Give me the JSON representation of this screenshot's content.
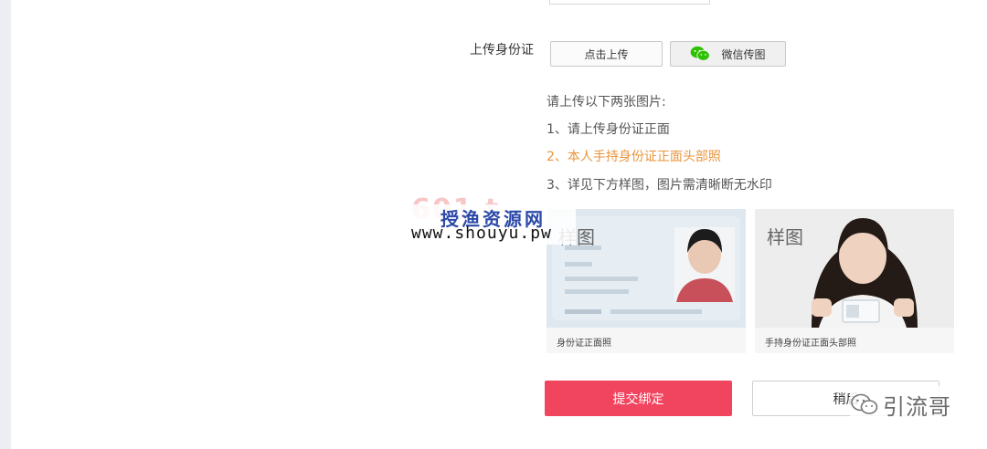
{
  "form": {
    "upload_label": "上传身份证",
    "upload_button": "点击上传",
    "wechat_button": "微信传图",
    "instructions": [
      "请上传以下两张图片:",
      "1、请上传身份证正面",
      "2、本人手持身份证正面头部照",
      "3、详见下方样图，图片需清晰断无水印"
    ],
    "highlight_color": "#e9953b"
  },
  "samples": [
    {
      "title": "样图",
      "caption": "身份证正面照"
    },
    {
      "title": "样图",
      "caption": "手持身份证正面头部照"
    }
  ],
  "actions": {
    "submit_label": "提交绑定",
    "submit_color": "#f1445f",
    "later_label": "稍后"
  },
  "watermark": {
    "site_cn": "授渔资源网",
    "site_url": "www.shouyu.pw"
  },
  "account_badge": {
    "name": "引流哥"
  }
}
